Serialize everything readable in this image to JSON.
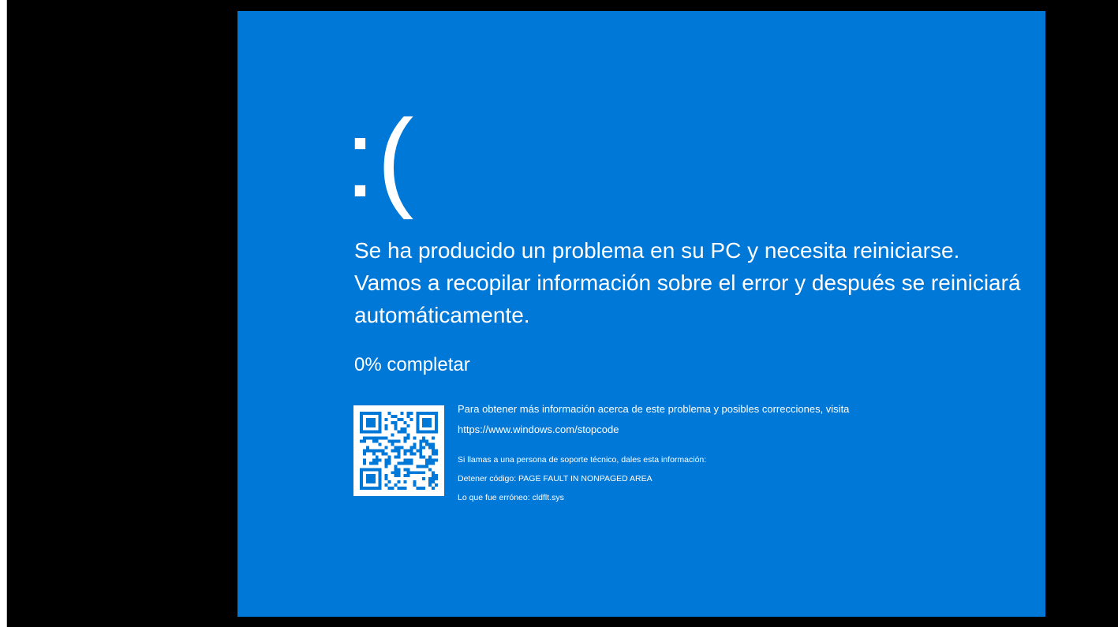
{
  "screen": {
    "background_color": "#0078d7",
    "text_color": "#ffffff",
    "frame_color": "#000000"
  },
  "face": ":(",
  "message": "Se ha producido un problema en su PC y necesita reiniciarse. Vamos a recopilar información sobre el error y después se reiniciará automáticamente.",
  "progress_label": "0% completar",
  "progress_percent": 0,
  "info": {
    "more_info_text": "Para obtener más información acerca de este problema y posibles correcciones, visita",
    "url": "https://www.windows.com/stopcode",
    "support_text": "Si llamas a una persona de soporte técnico, dales esta información:",
    "stop_code": "Detener código: PAGE FAULT IN NONPAGED AREA",
    "what_failed": "Lo que fue erróneo: cldflt.sys"
  },
  "qr_code_icon": "qr-code"
}
